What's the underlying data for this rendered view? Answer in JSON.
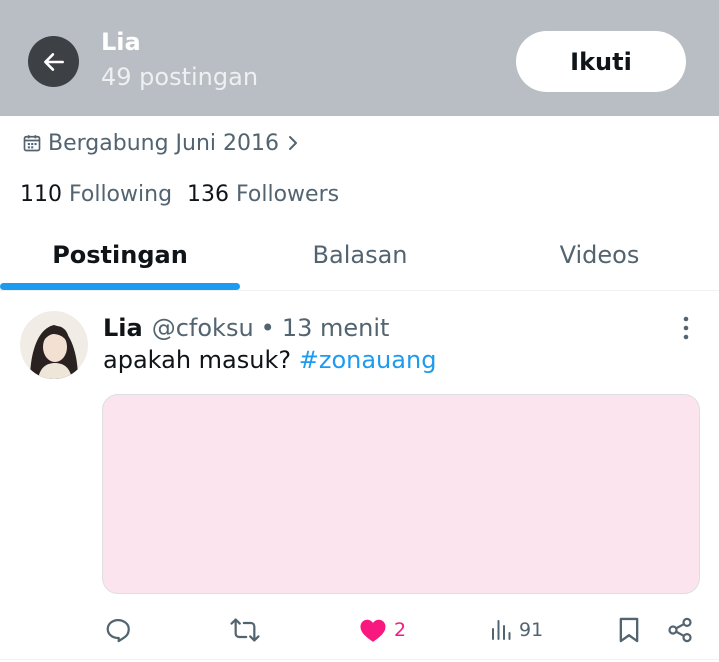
{
  "header": {
    "name": "Lia",
    "post_count": "49 postingan",
    "follow_label": "Ikuti",
    "back_icon": "arrow-left-icon"
  },
  "profile": {
    "joined": "Bergabung Juni 2016",
    "following_count": "110",
    "following_label": "Following",
    "followers_count": "136",
    "followers_label": "Followers"
  },
  "tabs": [
    {
      "label": "Postingan",
      "active": true
    },
    {
      "label": "Balasan",
      "active": false
    },
    {
      "label": "Videos",
      "active": false
    }
  ],
  "post": {
    "name": "Lia",
    "handle": "@cfoksu",
    "separator": "•",
    "time": "13 menit",
    "text": "apakah masuk? ",
    "hashtag": "#zonauang",
    "media_color": "#fce4ef",
    "actions": {
      "reply": {
        "icon": "reply-icon",
        "count": ""
      },
      "repost": {
        "icon": "repost-icon",
        "count": ""
      },
      "like": {
        "icon": "heart-icon",
        "count": "2",
        "liked": true
      },
      "views": {
        "icon": "views-icon",
        "count": "91"
      },
      "bookmark": {
        "icon": "bookmark-icon"
      },
      "share": {
        "icon": "share-icon"
      }
    }
  },
  "colors": {
    "header_bg": "#b8bec4",
    "accent": "#1d9bf0",
    "like": "#f91880",
    "muted": "#536471"
  }
}
